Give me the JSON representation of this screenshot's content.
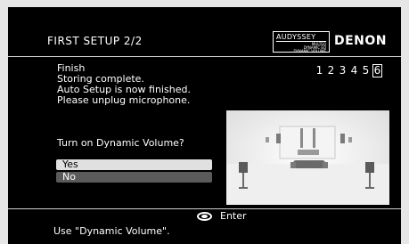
{
  "header": {
    "title": "FIRST SETUP 2/2",
    "logo_text": "AUDYSSEY",
    "logo_subtext": [
      "MULTEQ",
      "DYNAMIC EQ",
      "DYNAMIC VOLUME"
    ],
    "brand": "DENON"
  },
  "step_indicator": {
    "steps": [
      "1",
      "2",
      "3",
      "4",
      "5",
      "6"
    ],
    "current": "6"
  },
  "main": {
    "heading": "Finish",
    "lines": [
      "Storing complete.",
      "Auto Setup is now finished.",
      "Please unplug microphone."
    ],
    "question": "Turn on Dynamic Volume?",
    "options": [
      {
        "label": "Yes",
        "selected": true
      },
      {
        "label": "No",
        "selected": false
      }
    ]
  },
  "footer": {
    "enter_label": "Enter",
    "status_text": "Use \"Dynamic Volume\"."
  },
  "colors": {
    "screen_bg": "#000000",
    "page_bg": "#e6e6e6",
    "selected_option_bg": "#e0e0e0",
    "other_option_bg": "#5a5a5a"
  }
}
